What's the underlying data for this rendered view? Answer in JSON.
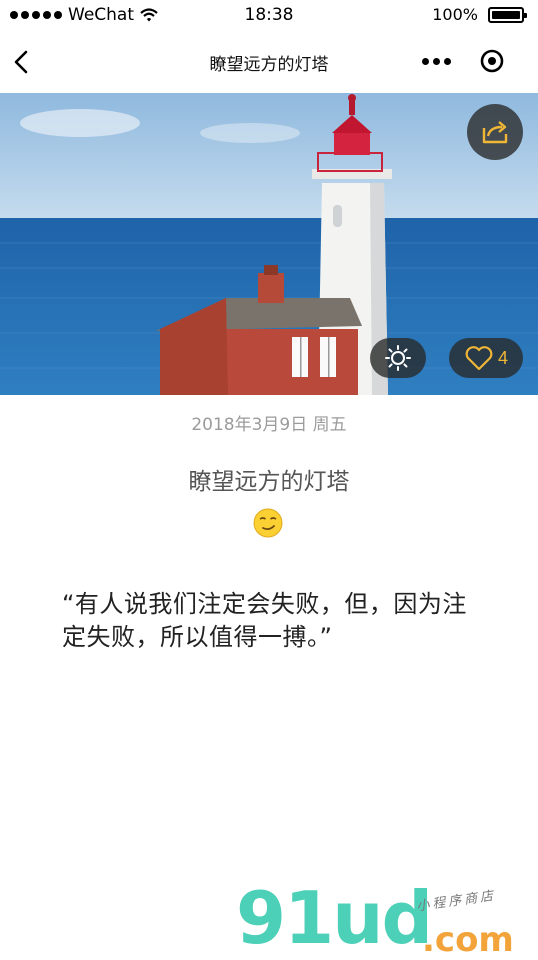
{
  "status_bar": {
    "carrier": "WeChat",
    "time": "18:38",
    "battery_text": "100%",
    "battery_level": 1.0,
    "signal_icon": "signal-dots-icon",
    "wifi_icon": "wifi-icon",
    "battery_icon": "battery-icon"
  },
  "nav": {
    "title": "瞭望远方的灯塔",
    "back_icon": "back-chevron-icon",
    "more_icon": "more-dots-icon",
    "close_icon": "target-close-icon"
  },
  "hero": {
    "share_icon": "share-icon",
    "sun_icon": "sun-icon",
    "heart_icon": "heart-icon",
    "like_count": "4",
    "accent_color": "#f0b636"
  },
  "post": {
    "date": "2018年3月9日 周五",
    "title": "瞭望远方的灯塔",
    "mood_icon": "smirk-emoji-icon",
    "quote": "“有人说我们注定会失败，但，因为注定失败，所以值得一搏。”"
  },
  "watermark": {
    "logo": "91ud",
    "suffix": ".com",
    "subtitle": "小程序商店"
  }
}
